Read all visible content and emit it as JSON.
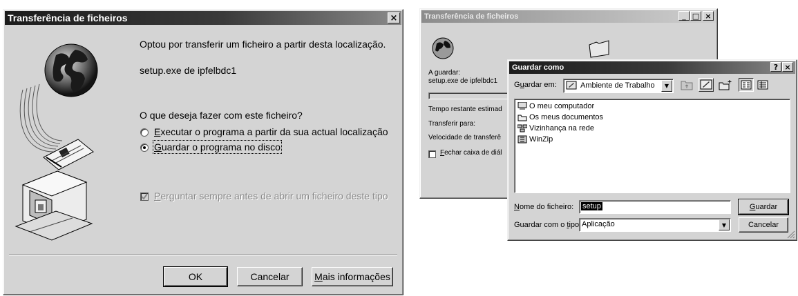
{
  "left_dialog": {
    "title": "Transferência de ficheiros",
    "close_label": "×",
    "intro": "Optou por transferir um ficheiro a partir desta localização.",
    "source": "setup.exe de ipfelbdc1",
    "question": "O que deseja fazer com este ficheiro?",
    "option_run": {
      "key": "E",
      "rest": "xecutar o programa a partir da sua actual localização",
      "selected": false
    },
    "option_save": {
      "key": "G",
      "rest": "uardar o programa no disco",
      "selected": true
    },
    "always_ask": {
      "key": "P",
      "rest": "erguntar sempre antes de abrir um ficheiro deste tipo",
      "checked": true,
      "disabled": true
    },
    "ok_label": "OK",
    "cancel_label": "Cancelar",
    "more_info": {
      "key": "M",
      "rest": "ais informações"
    }
  },
  "right_back_dialog": {
    "title": "Transferência de ficheiros",
    "saving_label": "A guardar:",
    "saving_file": "setup.exe de ipfelbdc1",
    "time_remaining": "Tempo restante estimad",
    "transfer_to": "Transferir para:",
    "transfer_speed": "Velocidade de transferê",
    "close_when_done": {
      "key": "F",
      "rest": "echar caixa de diál",
      "checked": false
    },
    "minimize_label": "_",
    "maximize_label": "□",
    "close_label": "×"
  },
  "save_dialog": {
    "title": "Guardar como",
    "help_label": "?",
    "close_label": "×",
    "save_in": {
      "pre": "G",
      "key": "u",
      "rest": "ardar em:"
    },
    "location": "Ambiente de Trabalho",
    "items": [
      {
        "label": "O meu computador",
        "icon": "computer-icon"
      },
      {
        "label": "Os meus documentos",
        "icon": "folder-icon"
      },
      {
        "label": "Vizinhança na rede",
        "icon": "network-icon"
      },
      {
        "label": "WinZip",
        "icon": "winzip-icon"
      }
    ],
    "filename_label": {
      "key": "N",
      "rest": "ome do ficheiro:"
    },
    "filename_value": "setup",
    "filetype_label": {
      "pre": "Guardar com o ",
      "key": "t",
      "rest": "ipo:"
    },
    "filetype_value": "Aplicação",
    "save_button": {
      "key": "G",
      "rest": "uardar"
    },
    "cancel_label": "Cancelar"
  }
}
